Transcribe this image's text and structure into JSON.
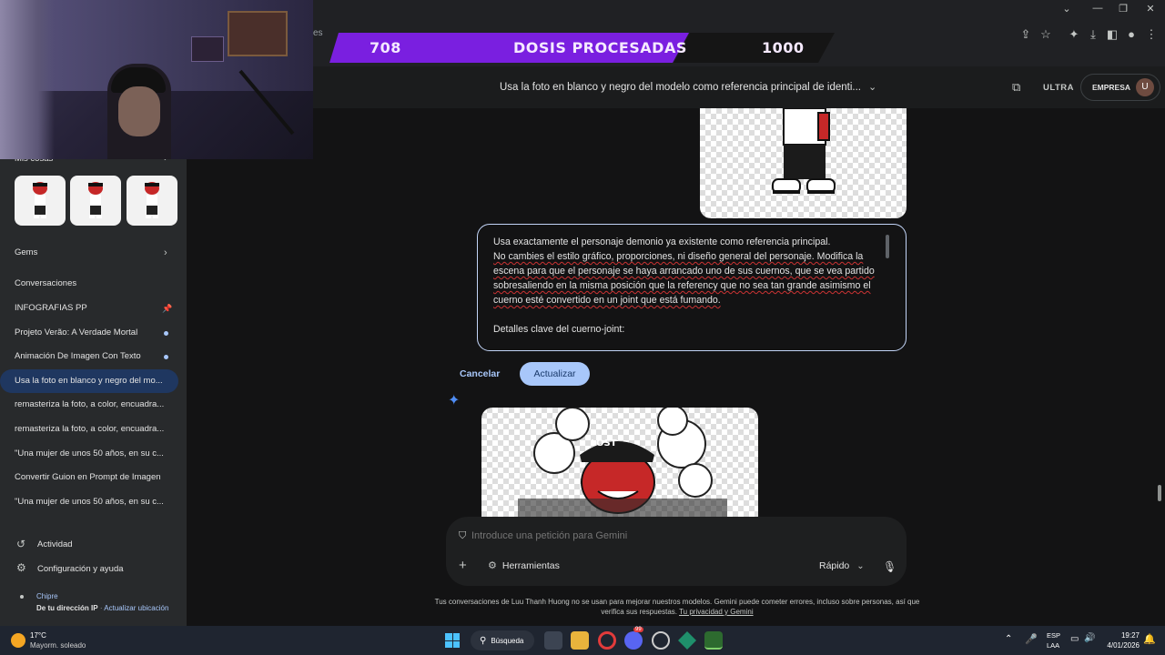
{
  "overlay": {
    "left_value": "708",
    "title": "DOSIS PROCESADAS",
    "right_value": "1000",
    "partial_tab_text": "es"
  },
  "header": {
    "conversation_title": "Usa la foto en blanco y negro del modelo como referencia principal de identi...",
    "plan_badge": "ULTRA",
    "account_label": "EMPRESA",
    "avatar_letter": "U"
  },
  "sidebar": {
    "my_stuff_label": "Mis cosas",
    "gems_label": "Gems",
    "conversations_label": "Conversaciones",
    "conversations": [
      {
        "title": "INFOGRAFIAS PP",
        "marker": "pin"
      },
      {
        "title": "Projeto Verão: A Verdade Mortal",
        "marker": "dot"
      },
      {
        "title": "Animación De Imagen Con Texto",
        "marker": "dot"
      },
      {
        "title": "Usa la foto en blanco y negro del mo...",
        "marker": "active"
      },
      {
        "title": "remasteriza la foto, a color, encuadra...",
        "marker": ""
      },
      {
        "title": "remasteriza la foto, a color, encuadra...",
        "marker": ""
      },
      {
        "title": "\"Una mujer de unos 50 años, en su c...",
        "marker": ""
      },
      {
        "title": "Convertir Guion en Prompt de Imagen",
        "marker": ""
      },
      {
        "title": "\"Una mujer de unos 50 años, en su c...",
        "marker": ""
      }
    ],
    "activity_label": "Actividad",
    "settings_label": "Configuración y ayuda",
    "location_name": "Chipre",
    "location_source": "De tu dirección IP",
    "location_separator": "·",
    "update_location": "Actualizar ubicación"
  },
  "editor": {
    "line1": "Usa exactamente el personaje demonio ya existente como referencia principal.",
    "line2": "No cambies el estilo gráfico, proporciones, ni diseño general del personaje. Modifica la escena para que el personaje se haya arrancado uno de sus cuernos, que se vea partido sobresaliendo en la misma posición que la referency que no sea tan grande asimismo el cuerno esté convertido en un joint que está fumando.",
    "line3": "Detalles clave del cuerno-joint:",
    "cancel_label": "Cancelar",
    "update_label": "Actualizar"
  },
  "image_overlay_text": "LOST",
  "composer": {
    "placeholder": "Introduce una petición para Gemini",
    "tools_label": "Herramientas",
    "model_label": "Rápido"
  },
  "footer": {
    "disclaimer": "Tus conversaciones de Luu Thanh Huong no se usan para mejorar nuestros modelos. Gemini puede cometer errores, incluso sobre personas, así que verifica sus respuestas.",
    "privacy_link": "Tu privacidad y Gemini"
  },
  "taskbar": {
    "temperature": "17°C",
    "weather": "Mayorm. soleado",
    "search_label": "Búsqueda",
    "lang_top": "ESP",
    "lang_bottom": "LAA",
    "time": "19:27",
    "date": "4/01/2026",
    "discord_badge": "99"
  },
  "colors": {
    "overlay_purple": "#7a1fe0",
    "accent_blue": "#a8c7fa",
    "update_button_bg": "#a8c7fa",
    "page_bg": "#131314",
    "sidebar_bg": "#282a2c"
  }
}
